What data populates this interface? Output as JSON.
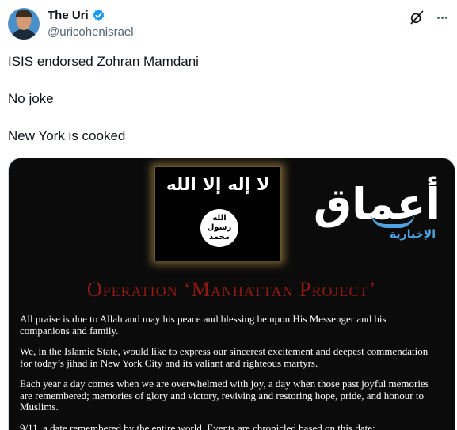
{
  "tweet": {
    "author_name": "The Uri",
    "handle": "@uricohenisrael",
    "paragraphs": [
      "ISIS endorsed Zohran Mamdani",
      "No joke",
      "New York is cooked"
    ]
  },
  "icons": {
    "verified": "verified-badge-icon",
    "grok": "grok-icon",
    "more": "more-options-icon"
  },
  "colors": {
    "verified": "#1d9bf0",
    "title_red": "#8e1a12",
    "logo_blue": "#4fa3e0"
  },
  "media": {
    "flag_text": "لا إله إلا الله",
    "seal_lines": [
      "الله",
      "رسول",
      "محمد"
    ],
    "logo_text": "أعماق",
    "logo_sub": "الإخبارية",
    "title": "Operation ‘Manhattan Project’",
    "statement": [
      "All praise is due to Allah and may his peace and blessing be upon His Messenger and his companions and family.",
      "We, in the Islamic State, would like to express our sincerest excitement and deepest commendation for today’s jihad in New York City and its valiant and righteous martyrs.",
      "Each year a day comes when we are overwhelmed with joy, a day when those past joyful memories are remembered; memories of glory and victory, reviving and restoring hope, pride, and honour to Muslims.",
      "9/11, a date remembered by the entire world. Events are chronicled based on this date;"
    ]
  }
}
